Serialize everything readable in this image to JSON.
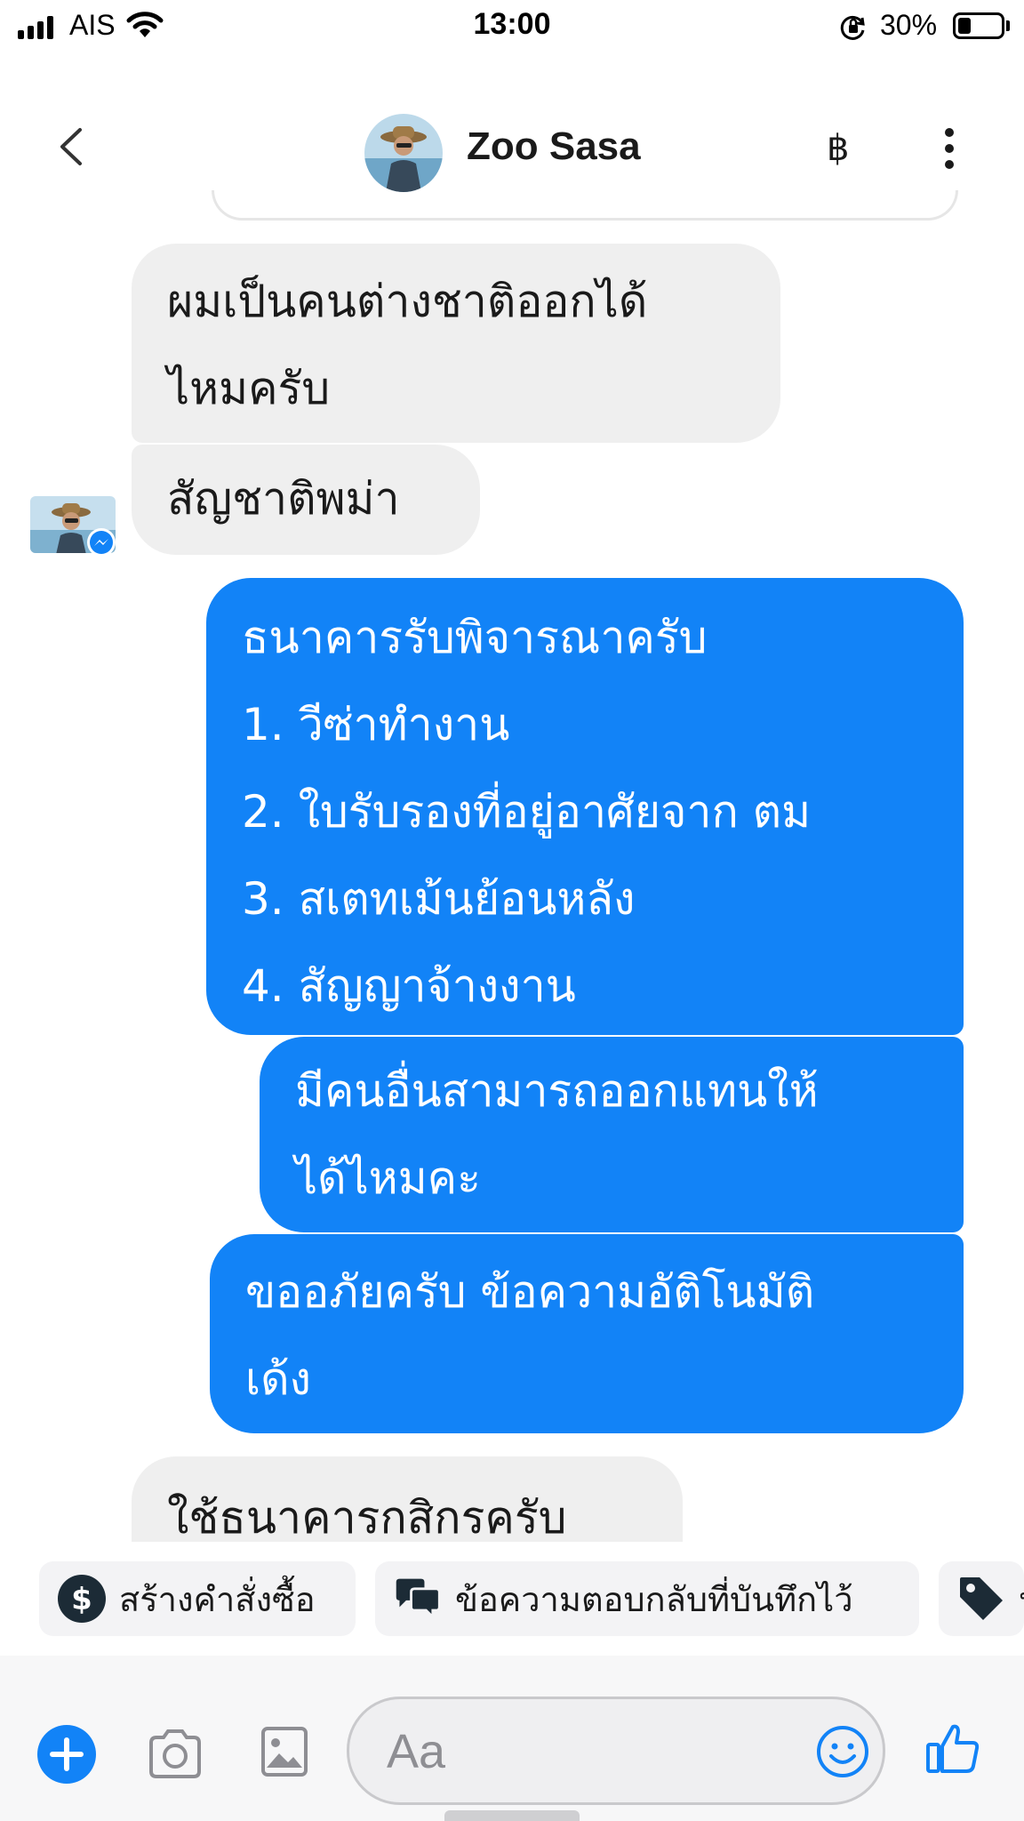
{
  "status_bar": {
    "carrier": "AIS",
    "time": "13:00",
    "battery": "30%",
    "battery_level": 0.3
  },
  "header": {
    "contact_name": "Zoo Sasa",
    "baht_symbol": "฿"
  },
  "messages": [
    {
      "side": "in",
      "lines": [
        "ผมเป็นคนต่างชาติออกได้",
        "ไหมครับ"
      ]
    },
    {
      "side": "in",
      "lines": [
        "สัญชาติพม่า"
      ]
    },
    {
      "side": "out",
      "lines": [
        "ธนาคารรับพิจารณาครับ",
        "1. วีซ่าทำงาน",
        "2. ใบรับรองที่อยู่อาศัยจาก ตม",
        "3. สเตทเม้นย้อนหลัง",
        "4. สัญญาจ้างงาน"
      ]
    },
    {
      "side": "out",
      "lines": [
        "มีคนอื่นสามารถออกแทนให้",
        "ได้ไหมคะ"
      ]
    },
    {
      "side": "out",
      "lines": [
        "ขออภัยครับ ข้อความอัติโนมัติ",
        "เด้ง"
      ]
    },
    {
      "side": "in",
      "lines": [
        "ใช้ธนาคารกสิกรครับ"
      ]
    }
  ],
  "quick_replies": [
    {
      "label": "สร้างคำสั่งซื้อ",
      "icon": "dollar-circle-icon"
    },
    {
      "label": "ข้อความตอบกลับที่บันทึกไว้",
      "icon": "chat-bubbles-icon"
    },
    {
      "label": "ป",
      "icon": "tag-icon"
    }
  ],
  "composer": {
    "placeholder": "Aa"
  },
  "colors": {
    "accent": "#1283f7",
    "incoming_bubble": "#efefef"
  }
}
